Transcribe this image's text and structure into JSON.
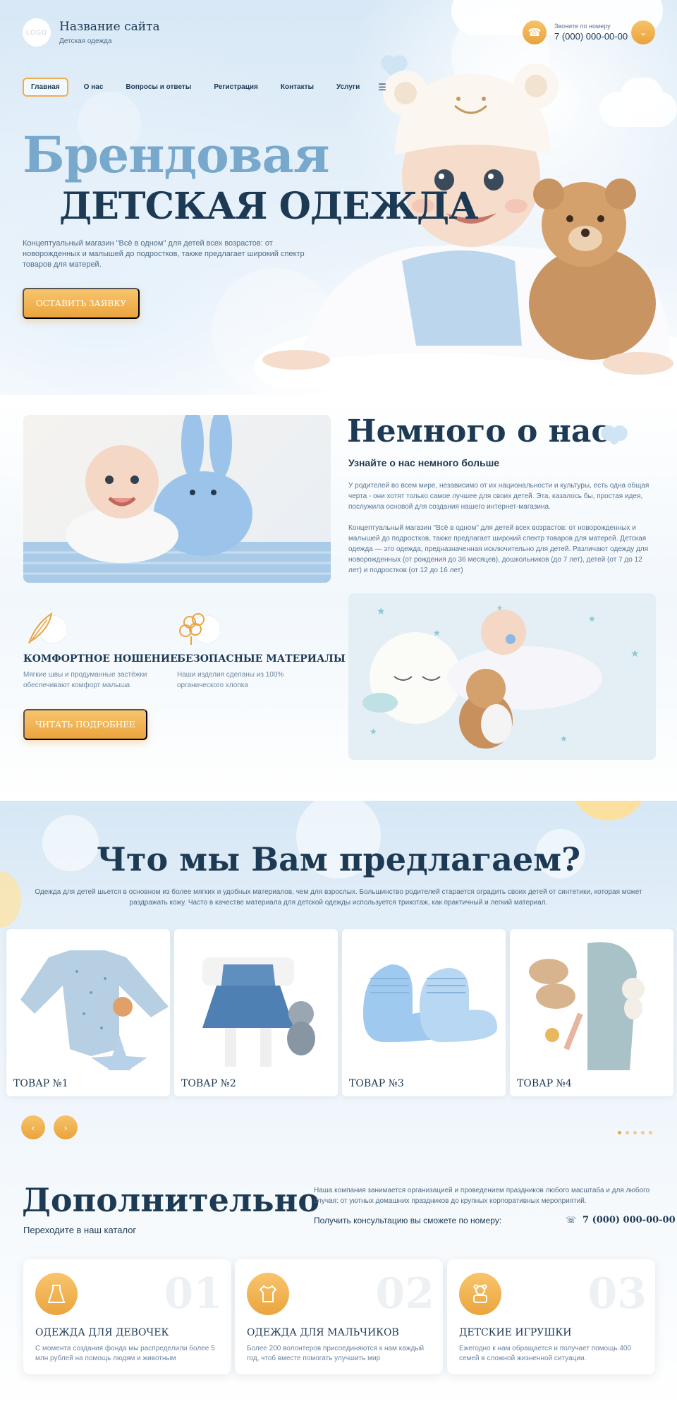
{
  "header": {
    "logo": "LOGO",
    "site_title": "Название сайта",
    "site_subtitle": "Детская одежда",
    "call_label": "Звоните по номеру",
    "phone": "7 (000) 000-00-00",
    "phone_icon": "phone-icon",
    "down_icon": "chevron-down-icon"
  },
  "nav": {
    "items": [
      "Главная",
      "О нас",
      "Вопросы и ответы",
      "Регистрация",
      "Контакты",
      "Услуги"
    ],
    "active_index": 0,
    "menu_icon": "menu-icon"
  },
  "hero": {
    "title_line1": "Брендовая",
    "title_line2": "ДЕТСКАЯ ОДЕЖДА",
    "description": "Концептуальный магазин \"Всё в одном\" для детей всех возрастов: от новорожденных и малышей до подростков, также предлагает широкий спектр товаров для матерей.",
    "button": "ОСТАВИТЬ ЗАЯВКУ"
  },
  "about": {
    "title": "Немного о нас",
    "subtitle": "Узнайте о нас немного больше",
    "paragraph1": "У родителей во всем мире, независимо от их национальности и культуры, есть одна общая черта - они хотят только самое лучшее для своих детей. Эта, казалось бы, простая идея, послужила основой для создания нашего интернет-магазина.",
    "paragraph2": "Концептуальный магазин \"Всё в одном\" для детей всех возрастов: от новорожденных и малышей до подростков, также предлагает широкий спектр товаров для матерей. Детская одежда — это одежда, предназначенная исключительно для детей. Различают одежду для новорожденных (от рождения до 36 месяцев), дошкольников (до 7 лет), детей (от 7 до 12 лет) и подростков (от 12 до 16 лет)",
    "features": [
      {
        "icon": "feather-icon",
        "title": "КОМФОРТНОЕ НОШЕНИЕ",
        "text": "Мягкие швы и продуманные застёжки обеспечивают комфорт малыша"
      },
      {
        "icon": "cotton-icon",
        "title": "БЕЗОПАСНЫЕ МАТЕРИАЛЫ",
        "text": "Наши изделия сделаны из 100% органического хлопка"
      }
    ],
    "button": "ЧИТАТЬ ПОДРОБНЕЕ"
  },
  "offer": {
    "title": "Что мы Вам предлагаем?",
    "description": "Одежда для детей шьется в основном из более мягких и удобных материалов, чем для взрослых. Большинство родителей старается оградить своих детей от синтетики, которая может раздражать кожу. Часто в качестве материала для детской одежды используется трикотаж, как практичный и легкий материал.",
    "products": [
      {
        "label": "ТОВАР №1"
      },
      {
        "label": "ТОВАР №2"
      },
      {
        "label": "ТОВАР №3"
      },
      {
        "label": "ТОВАР №4"
      }
    ],
    "prev_icon": "chevron-left-icon",
    "next_icon": "chevron-right-icon",
    "pagination": {
      "total": 5,
      "active": 0
    }
  },
  "extra": {
    "title": "Дополнительно",
    "subtitle": "Переходите в наш каталог",
    "description": "Наша компания занимается организацией и проведением праздников любого масштаба и для любого случая: от уютных домашних праздников до крупных корпоративных мероприятий.",
    "consult": "Получить консультацию вы сможете по номеру:",
    "phone": "7 (000) 000-00-00",
    "categories": [
      {
        "num": "01",
        "icon": "dress-icon",
        "title": "ОДЕЖДА ДЛЯ ДЕВОЧЕК",
        "text": "С момента создания фонда мы распределили более 5 млн рублей на помощь людям и животным"
      },
      {
        "num": "02",
        "icon": "shirt-icon",
        "title": "ОДЕЖДА ДЛЯ МАЛЬЧИКОВ",
        "text": "Более 200 волонтеров присоединяются к нам каждый год, чтоб вместе помогать улучшить мир"
      },
      {
        "num": "03",
        "icon": "toy-icon",
        "title": "ДЕТСКИЕ ИГРУШКИ",
        "text": "Ежегодно к нам обращается и получает помощь 400 семей в сложной жизненной ситуации."
      }
    ]
  },
  "colors": {
    "accent": "#eba43e",
    "dark": "#1d3a55",
    "light_blue": "#78a9cc"
  }
}
